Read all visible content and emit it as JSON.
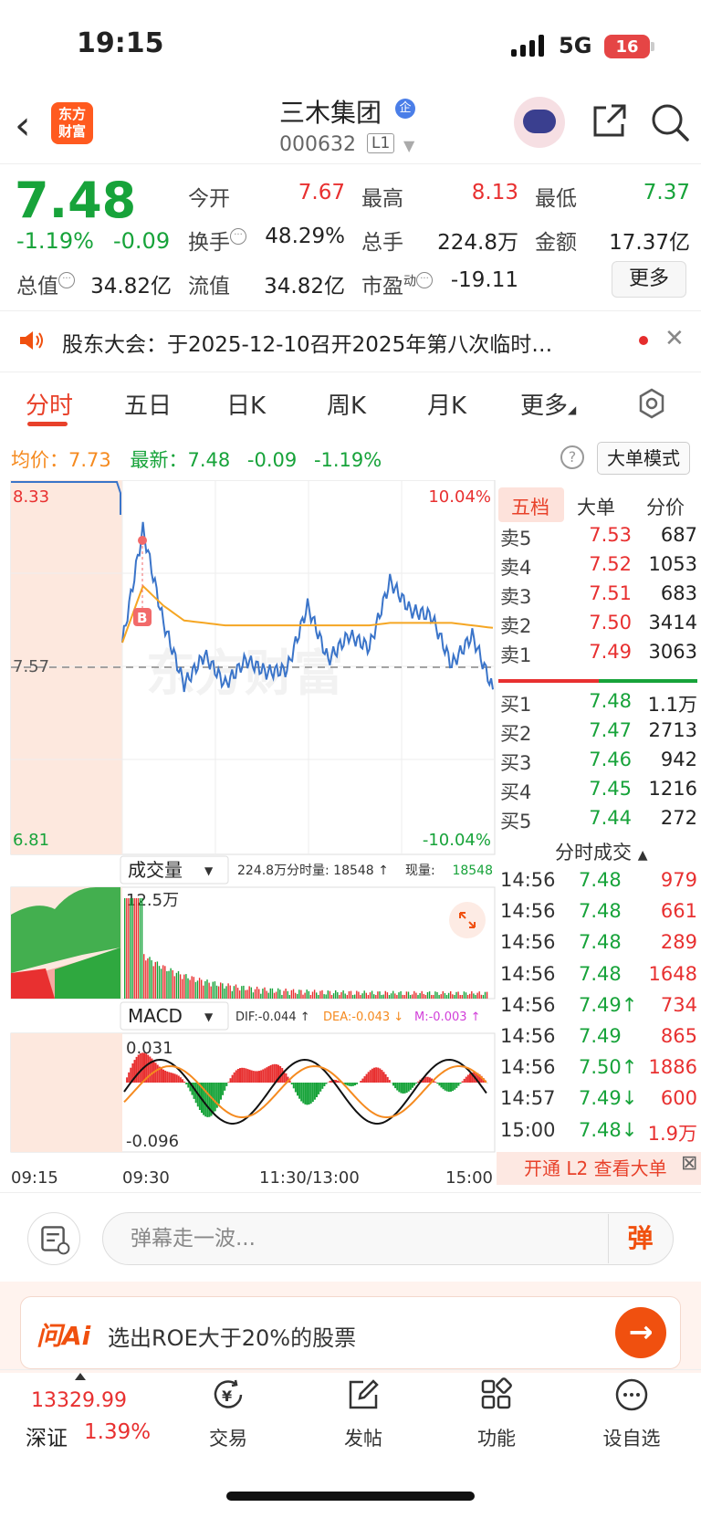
{
  "status_bar": {
    "time": "19:15",
    "network": "5G",
    "battery": "16"
  },
  "header": {
    "stock_name": "三木集团",
    "badge": "企",
    "stock_code": "000632",
    "level": "L1",
    "logo_line1": "东方",
    "logo_line2": "财富"
  },
  "quote": {
    "price": "7.48",
    "change_pct": "-1.19%",
    "change": "-0.09",
    "open_label": "今开",
    "open": "7.67",
    "high_label": "最高",
    "high": "8.13",
    "low_label": "最低",
    "low": "7.37",
    "turnover_label": "换手",
    "turnover": "48.29%",
    "volume_label": "总手",
    "volume": "224.8万",
    "amount_label": "金额",
    "amount": "17.37亿",
    "mktcap_label": "总值",
    "mktcap": "34.82亿",
    "float_label": "流值",
    "float_cap": "34.82亿",
    "pe_label": "市盈",
    "pe_sup": "动",
    "pe": "-19.11",
    "more_button": "更多"
  },
  "ticker": {
    "text": "股东大会：于2025-12-10召开2025年第八次临时…"
  },
  "tabs": [
    "分时",
    "五日",
    "日K",
    "周K",
    "月K",
    "更多"
  ],
  "info_line": {
    "avg_label": "均价：",
    "avg": "7.73",
    "latest_label": "最新：",
    "latest": "7.48",
    "chg": "-0.09",
    "pct": "-1.19%",
    "big_order_mode": "大单模式"
  },
  "chart_labels": {
    "y_top": "8.33",
    "y_mid": "7.57",
    "y_bottom": "6.81",
    "pct_top": "10.04%",
    "pct_bottom": "-10.04%",
    "vol_selector": "成交量",
    "vol_info1": "224.8万",
    "vol_info2": "分时量: 18548 ↑",
    "vol_info3": "现量:",
    "vol_info3_val": "18548",
    "vol_max": "12.5万",
    "macd_selector": "MACD",
    "dif": "DIF:-0.044 ↑",
    "dea": "DEA:-0.043 ↓",
    "m": "M:-0.003 ↑",
    "macd_top": "0.031",
    "macd_bottom": "-0.096",
    "x_ticks": [
      "09:15",
      "09:30",
      "11:30/13:00",
      "15:00"
    ],
    "watermark": "东方财富"
  },
  "chart_data": {
    "type": "line",
    "title": "",
    "xlabel": "",
    "ylabel": "",
    "ylim": [
      6.81,
      8.33
    ],
    "prev_close": 7.57,
    "x": [
      "09:30",
      "09:35",
      "09:45",
      "10:00",
      "10:15",
      "10:30",
      "10:45",
      "11:00",
      "11:15",
      "11:30",
      "13:00",
      "13:15",
      "13:30",
      "13:45",
      "14:00",
      "14:15",
      "14:30",
      "14:45",
      "15:00"
    ],
    "series": [
      {
        "name": "最新",
        "values": [
          7.67,
          8.13,
          7.75,
          7.5,
          7.62,
          7.5,
          7.6,
          7.55,
          7.56,
          7.82,
          7.6,
          7.7,
          7.65,
          7.92,
          7.8,
          7.78,
          7.58,
          7.7,
          7.48
        ]
      },
      {
        "name": "均价",
        "values": [
          7.67,
          7.9,
          7.82,
          7.76,
          7.75,
          7.74,
          7.74,
          7.74,
          7.74,
          7.74,
          7.74,
          7.74,
          7.74,
          7.75,
          7.75,
          7.75,
          7.75,
          7.74,
          7.73
        ]
      }
    ]
  },
  "order_book": {
    "tabs": [
      "五档",
      "大单",
      "分价"
    ],
    "asks": [
      {
        "label": "卖5",
        "price": "7.53",
        "vol": "687"
      },
      {
        "label": "卖4",
        "price": "7.52",
        "vol": "1053"
      },
      {
        "label": "卖3",
        "price": "7.51",
        "vol": "683"
      },
      {
        "label": "卖2",
        "price": "7.50",
        "vol": "3414"
      },
      {
        "label": "卖1",
        "price": "7.49",
        "vol": "3063"
      }
    ],
    "bids": [
      {
        "label": "买1",
        "price": "7.48",
        "vol": "1.1万"
      },
      {
        "label": "买2",
        "price": "7.47",
        "vol": "2713"
      },
      {
        "label": "买3",
        "price": "7.46",
        "vol": "942"
      },
      {
        "label": "买4",
        "price": "7.45",
        "vol": "1216"
      },
      {
        "label": "买5",
        "price": "7.44",
        "vol": "272"
      }
    ]
  },
  "trades": {
    "title": "分时成交",
    "rows": [
      {
        "time": "14:56",
        "price": "7.48",
        "vol": "979"
      },
      {
        "time": "14:56",
        "price": "7.48",
        "vol": "661"
      },
      {
        "time": "14:56",
        "price": "7.48",
        "vol": "289"
      },
      {
        "time": "14:56",
        "price": "7.48",
        "vol": "1648"
      },
      {
        "time": "14:56",
        "price": "7.49↑",
        "vol": "734"
      },
      {
        "time": "14:56",
        "price": "7.49",
        "vol": "865"
      },
      {
        "time": "14:56",
        "price": "7.50↑",
        "vol": "1886"
      },
      {
        "time": "14:57",
        "price": "7.49↓",
        "vol": "600"
      },
      {
        "time": "15:00",
        "price": "7.48↓",
        "vol": "1.9万"
      }
    ],
    "l2_banner": "开通 L2 查看大单"
  },
  "danmaku": {
    "placeholder": "弹幕走一波...",
    "button": "弹"
  },
  "ai": {
    "logo": "问Ai",
    "text": "选出ROE大于20%的股票",
    "go": "→"
  },
  "bottom_nav": {
    "index_value": "13329.99",
    "index_name": "深证",
    "index_pct": "1.39%",
    "items": [
      "交易",
      "发帖",
      "功能",
      "设自选"
    ]
  }
}
